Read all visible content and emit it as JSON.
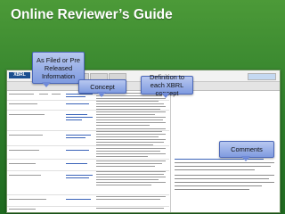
{
  "slide": {
    "title": "Online Reviewer’s Guide"
  },
  "callouts": {
    "as_filed": "As Filed or Pre Released Information",
    "concept": "Concept",
    "definition": "Definition to each XBRL concept",
    "comments": "Comments"
  },
  "app": {
    "logo_text": "XBRL",
    "toolbar_tabs": [
      "tab",
      "tab",
      "tab",
      "tab",
      "tab",
      "tab"
    ]
  },
  "colors": {
    "background": "#2e7d2a",
    "callout_fill": "#8fa6e6",
    "callout_border": "#4c68b8",
    "link": "#1f4ea8"
  }
}
